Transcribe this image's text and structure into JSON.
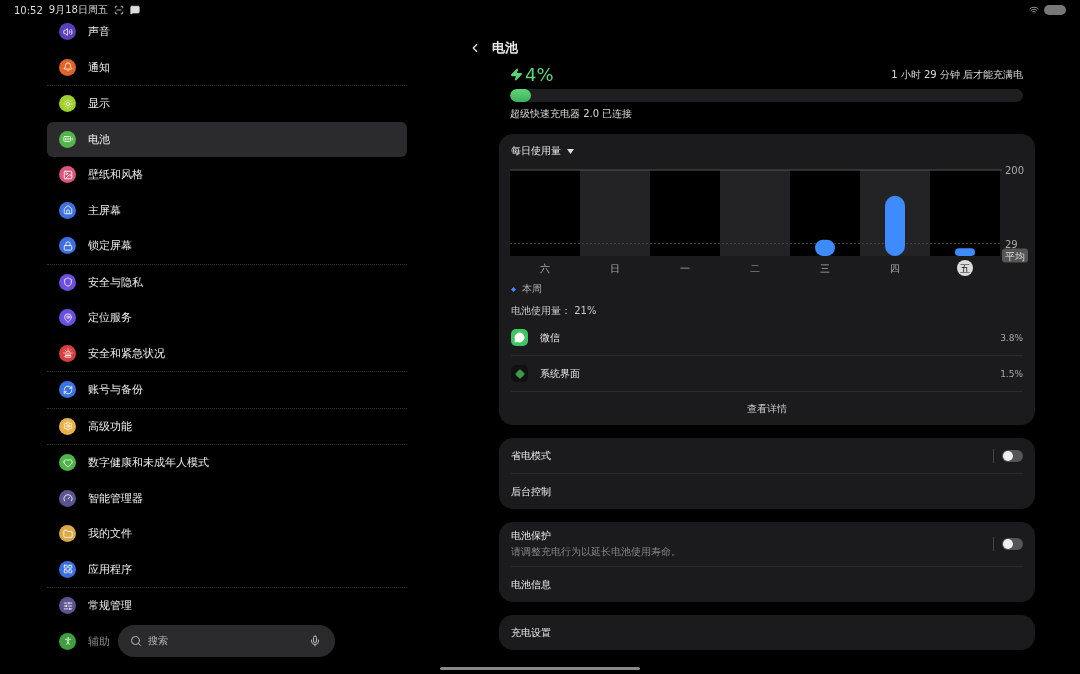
{
  "status_bar": {
    "time": "10:52",
    "date": "9月18日周五"
  },
  "sidebar": {
    "groups": [
      [
        {
          "label": "声音",
          "color": "#5b3fb8",
          "selected": false,
          "faded": false
        },
        {
          "label": "通知",
          "color": "#e0642a",
          "selected": false,
          "faded": false
        }
      ],
      [
        {
          "label": "显示",
          "color": "#9fcf2c",
          "selected": false,
          "faded": false
        },
        {
          "label": "电池",
          "color": "#53b54a",
          "selected": true,
          "faded": false
        },
        {
          "label": "壁纸和风格",
          "color": "#d9557a",
          "selected": false,
          "faded": false
        },
        {
          "label": "主屏幕",
          "color": "#3d72e0",
          "selected": false,
          "faded": false
        },
        {
          "label": "锁定屏幕",
          "color": "#3d6fe0",
          "selected": false,
          "faded": false
        }
      ],
      [
        {
          "label": "安全与隐私",
          "color": "#6e4fe0",
          "selected": false,
          "faded": false
        },
        {
          "label": "定位服务",
          "color": "#6a4fe0",
          "selected": false,
          "faded": false
        },
        {
          "label": "安全和紧急状况",
          "color": "#d84040",
          "selected": false,
          "faded": false
        }
      ],
      [
        {
          "label": "账号与备份",
          "color": "#3b74e0",
          "selected": false,
          "faded": false
        }
      ],
      [
        {
          "label": "高级功能",
          "color": "#e7b24a",
          "selected": false,
          "faded": false
        }
      ],
      [
        {
          "label": "数字健康和未成年人模式",
          "color": "#4fb548",
          "selected": false,
          "faded": false
        },
        {
          "label": "智能管理器",
          "color": "#5a5590",
          "selected": false,
          "faded": false
        },
        {
          "label": "我的文件",
          "color": "#d9a94a",
          "selected": false,
          "faded": false
        },
        {
          "label": "应用程序",
          "color": "#3b6fe0",
          "selected": false,
          "faded": false
        }
      ],
      [
        {
          "label": "常规管理",
          "color": "#5a5590",
          "selected": false,
          "faded": false
        },
        {
          "label": "辅助",
          "color": "#3f9f3c",
          "selected": false,
          "faded": true
        }
      ]
    ]
  },
  "search": {
    "placeholder": "搜索"
  },
  "header": {
    "title": "电池"
  },
  "battery": {
    "percent": "4%",
    "level": 0.04,
    "time_to_full": "1 小时 29 分钟 后才能充满电",
    "charger": "超级快速充电器 2.0 已连接"
  },
  "usage": {
    "title": "每日使用量",
    "days_selected": [
      false,
      false,
      false,
      false,
      false,
      false,
      true
    ],
    "chart_data": {
      "type": "bar",
      "categories": [
        "六",
        "日",
        "一",
        "二",
        "三",
        "四",
        "五"
      ],
      "series": [
        {
          "name": "本周",
          "color": "#3d8bfd",
          "values": [
            null,
            null,
            null,
            null,
            38,
            140,
            18
          ]
        }
      ],
      "ylim": [
        0,
        200
      ],
      "yticks": [
        {
          "value": 200,
          "label": "200"
        },
        {
          "value": 29,
          "label": "29"
        }
      ]
    },
    "average_label": "平均",
    "total": "电池使用量： 21%",
    "apps": [
      {
        "name": "微信",
        "value": "3.8%"
      },
      {
        "name": "系统界面",
        "value": "1.5%"
      }
    ],
    "details_button": "查看详情"
  },
  "cards": [
    [
      {
        "label": "省电模式",
        "kind": "toggle",
        "on": false
      },
      {
        "label": "后台控制",
        "kind": "link"
      }
    ],
    [
      {
        "label": "电池保护",
        "kind": "toggle",
        "on": false,
        "description": "请调整充电行为以延长电池使用寿命。"
      },
      {
        "label": "电池信息",
        "kind": "link"
      }
    ],
    [
      {
        "label": "充电设置",
        "kind": "link"
      }
    ]
  ]
}
